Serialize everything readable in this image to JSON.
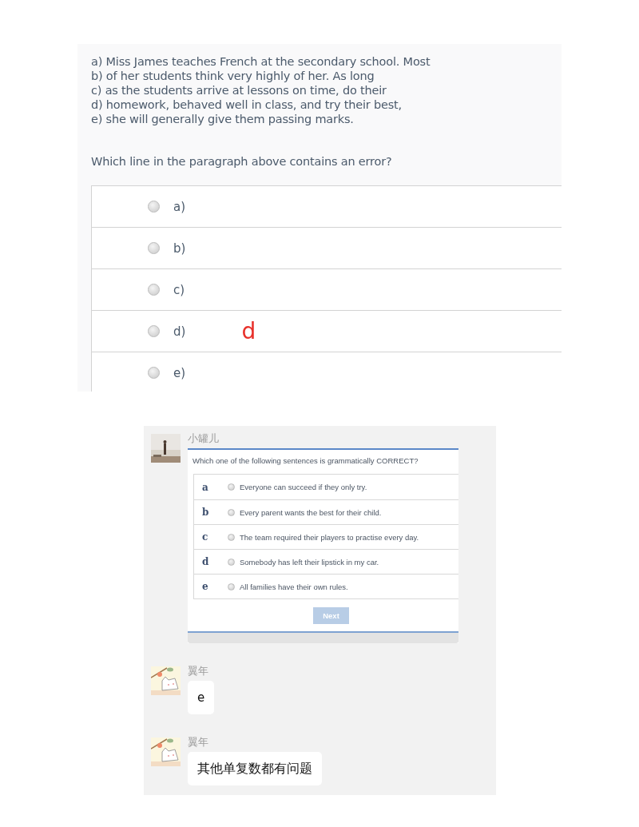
{
  "exercise": {
    "passage_lines": [
      "a) Miss James teaches French at the secondary school. Most",
      "b) of her students think very highly of her. As long",
      "c) as the students arrive at lessons on time, do their",
      "d) homework, behaved well in class, and try their best,",
      "e) she will generally give them passing marks."
    ],
    "question": "Which line in the paragraph above contains an error?",
    "options": [
      {
        "label": "a)",
        "selected": false
      },
      {
        "label": "b)",
        "selected": false
      },
      {
        "label": "c)",
        "selected": false
      },
      {
        "label": "d)",
        "selected": false,
        "note": "d"
      },
      {
        "label": "e)",
        "selected": false
      }
    ]
  },
  "chat": {
    "messages": [
      {
        "kind": "quiz",
        "sender": "小罐儿",
        "question": "Which one of the following sentences is grammatically CORRECT?",
        "options": [
          {
            "letter": "a",
            "text": "Everyone can succeed if they only try.",
            "selected": false
          },
          {
            "letter": "b",
            "text": "Every parent wants the best for their child.",
            "selected": false
          },
          {
            "letter": "c",
            "text": "The team required their players to practise every day.",
            "selected": false
          },
          {
            "letter": "d",
            "text": "Somebody has left their lipstick in my car.",
            "selected": false
          },
          {
            "letter": "e",
            "text": "All families have their own rules.",
            "selected": false
          }
        ],
        "button": {
          "label": "Next",
          "disabled": true
        }
      },
      {
        "kind": "text",
        "sender": "翼年",
        "avatar": {
          "kind": "drawing"
        },
        "text": "e"
      },
      {
        "kind": "text",
        "sender": "翼年",
        "avatar": {
          "kind": "drawing"
        },
        "text": "其他单复数都有问题"
      }
    ]
  }
}
